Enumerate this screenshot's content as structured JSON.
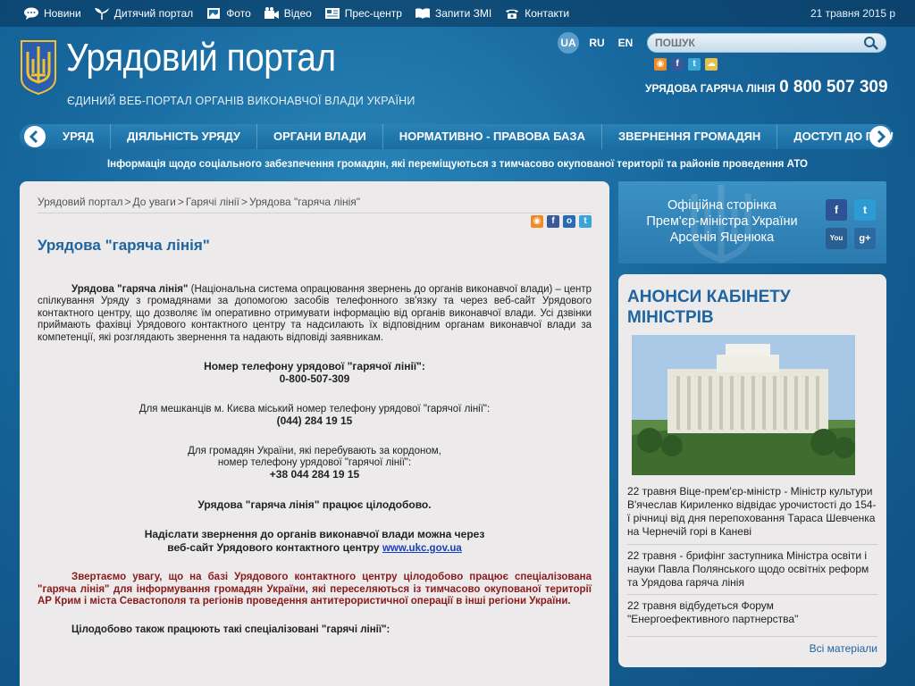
{
  "topbar": {
    "items": [
      {
        "label": "Новини",
        "icon": "speech-bubble-icon"
      },
      {
        "label": "Дитячий портал",
        "icon": "sprout-icon"
      },
      {
        "label": "Фото",
        "icon": "photo-icon"
      },
      {
        "label": "Відео",
        "icon": "video-camera-icon"
      },
      {
        "label": "Прес-центр",
        "icon": "document-icon"
      },
      {
        "label": "Запити ЗМІ",
        "icon": "book-icon"
      },
      {
        "label": "Контакти",
        "icon": "phone-icon"
      }
    ],
    "date": "21 травня 2015 р"
  },
  "header": {
    "title": "Урядовий портал",
    "subtitle": "ЄДИНИЙ ВЕБ-ПОРТАЛ ОРГАНІВ ВИКОНАВЧОЇ ВЛАДИ УКРАЇНИ",
    "languages": [
      "UA",
      "RU",
      "EN"
    ],
    "search_placeholder": "ПОШУК",
    "hotline_label": "УРЯДОВА ГАРЯЧА ЛІНІЯ",
    "hotline_number": "0 800 507 309"
  },
  "nav": {
    "items": [
      "УРЯД",
      "ДІЯЛЬНІСТЬ УРЯДУ",
      "ОРГАНИ ВЛАДИ",
      "НОРМАТИВНО - ПРАВОВА БАЗА",
      "ЗВЕРНЕННЯ ГРОМАДЯН",
      "ДОСТУП ДО ПУБЛІ"
    ]
  },
  "announcement": "Інформація щодо соціального забезпечення громадян, які переміщуються з тимчасово окупованої території та районів проведення АТО",
  "breadcrumb": [
    "Урядовий портал",
    "До уваги",
    "Гарячі лінії",
    "Урядова \"гаряча лінія\""
  ],
  "article": {
    "title": "Урядова \"гаряча лінія\"",
    "intro_bold": "Урядова \"гаряча лінія\"",
    "intro_text": " (Національна система опрацювання звернень до органів виконавчої влади) – центр спілкування Уряду з громадянами за допомогою засобів телефонного зв'язку та через веб-сайт Урядового контактного центру, що дозволяє їм оперативно отримувати інформацію від органів виконавчої влади. Усі дзвінки приймають фахівці Урядового контактного центру та надсилають їх відповідним органам виконавчої влади за компетенції, які розглядають звернення та надають відповіді заявникам.",
    "phone_label": "Номер телефону урядової \"гарячої лінії\":",
    "phone": "0-800-507-309",
    "kyiv_label": "Для мешканців м. Києва міський номер телефону урядової \"гарячої лінії\":",
    "kyiv_phone": "(044) 284 19 15",
    "abroad_label_1": "Для громадян України, які перебувають за кордоном,",
    "abroad_label_2": "номер телефону урядової \"гарячої лінії\":",
    "abroad_phone": "+38 044 284 19 15",
    "allday": "Урядова \"гаряча лінія\" працює цілодобово.",
    "send_1": "Надіслати звернення до органів виконавчої влади можна через",
    "send_2": "веб-сайт Урядового контактного центру ",
    "send_link": "www.ukc.gov.ua",
    "notice": "Звертаємо увагу, що на базі Урядового контактного центру цілодобово працює спеціалізована \"гаряча лінія\" для інформування громадян України, які переселяються із тимчасово окупованої території АР Крим і міста Севастополя та регіонів проведення антитерористичної операції в інші регіони України.",
    "also": "Цілодобово також працюють такі спеціалізовані \"гарячі лінії\":"
  },
  "pm": {
    "line1": "Офіційна сторінка",
    "line2": "Прем'єр-міністра України",
    "line3": "Арсенія Яценюка",
    "social": [
      "facebook-icon",
      "twitter-icon",
      "youtube-icon",
      "google-plus-icon"
    ]
  },
  "sidebar": {
    "title_1": "АНОНСИ КАБІНЕТУ",
    "title_2": "МІНІСТРІВ",
    "news": [
      "22 травня Віце-прем'єр-міністр - Міністр культури В'ячеслав Кириленко відвідає урочистості до 154-ї річниці від дня перепоховання Тараса Шевченка на Чернечій горі в Каневі",
      "22 травня - брифінг заступника Міністра освіти і науки Павла Полянського щодо освітніх реформ та Урядова гаряча лінія",
      "22 травня відбудеться Форум \"Енергоефективного партнерства\""
    ],
    "more": "Всі матеріали"
  },
  "colors": {
    "background": "#17689e",
    "accent": "#1f64a0",
    "notice": "#8b1a1a",
    "link": "#1a3fb8"
  }
}
